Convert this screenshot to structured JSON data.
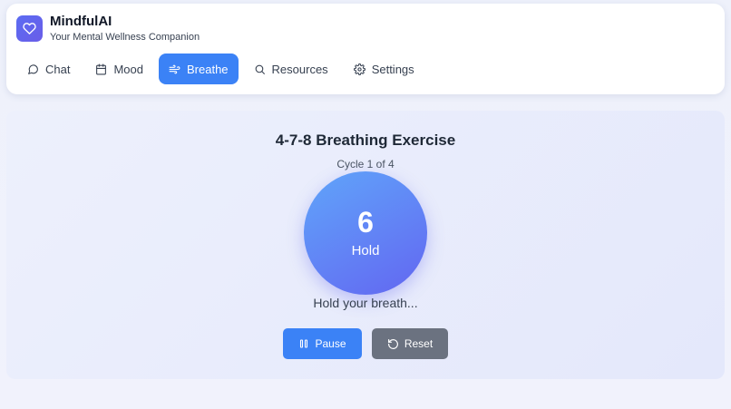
{
  "app": {
    "name": "MindfulAI",
    "tagline": "Your Mental Wellness Companion",
    "logo_icon": "heart-icon"
  },
  "nav": {
    "items": [
      {
        "label": "Chat",
        "icon": "chat-icon",
        "active": false
      },
      {
        "label": "Mood",
        "icon": "calendar-icon",
        "active": false
      },
      {
        "label": "Breathe",
        "icon": "wind-icon",
        "active": true
      },
      {
        "label": "Resources",
        "icon": "search-icon",
        "active": false
      },
      {
        "label": "Settings",
        "icon": "gear-icon",
        "active": false
      }
    ]
  },
  "exercise": {
    "title": "4-7-8 Breathing Exercise",
    "cycle_text": "Cycle 1 of 4",
    "count": "6",
    "phase": "Hold",
    "instruction": "Hold your breath..."
  },
  "controls": {
    "pause_label": "Pause",
    "reset_label": "Reset"
  },
  "colors": {
    "accent": "#3b82f6",
    "secondary_button": "#6b7280",
    "circle_gradient_start": "#60a5fa",
    "circle_gradient_end": "#6366f1"
  }
}
